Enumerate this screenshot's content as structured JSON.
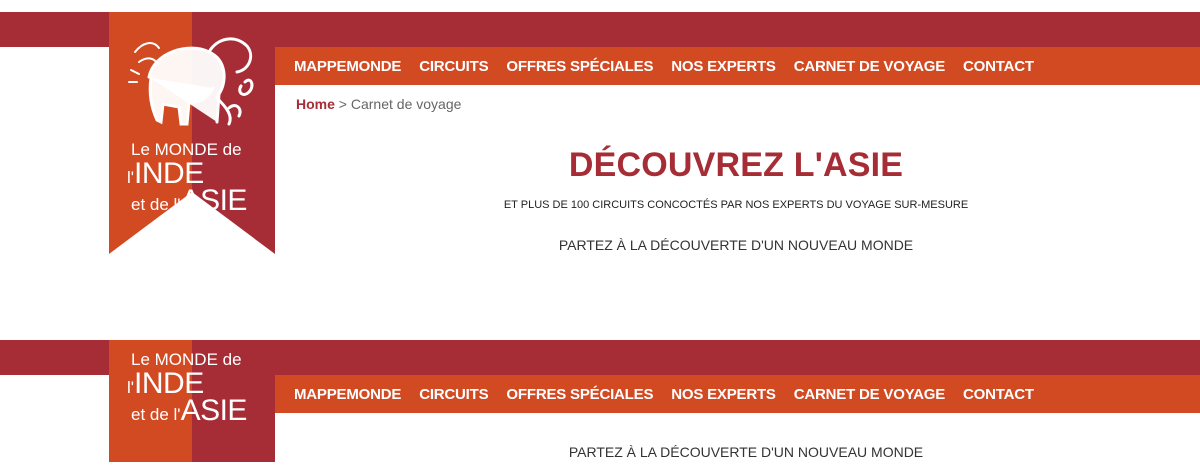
{
  "brand": {
    "line1": "Le MONDE de",
    "line2_small": "l'",
    "line2_big": "INDE",
    "line3_small": "et de l'",
    "line3_big": "ASIE",
    "colors": {
      "primary": "#a62d36",
      "accent": "#d24a22"
    }
  },
  "nav": {
    "items": [
      "MAPPEMONDE",
      "CIRCUITS",
      "OFFRES SPÉCIALES",
      "NOS EXPERTS",
      "CARNET DE VOYAGE",
      "CONTACT"
    ]
  },
  "breadcrumb": {
    "home": "Home",
    "separator": ">",
    "current": "Carnet de voyage"
  },
  "hero": {
    "title": "DÉCOUVREZ L'ASIE",
    "subtitle": "ET PLUS DE 100 CIRCUITS CONCOCTÉS PAR NOS EXPERTS DU VOYAGE SUR-MESURE",
    "tagline": "PARTEZ À LA DÉCOUVERTE D'UN NOUVEAU MONDE"
  },
  "sticky": {
    "tagline": "PARTEZ À LA DÉCOUVERTE D'UN NOUVEAU MONDE"
  },
  "icons": {
    "logo": "elephant-icon"
  }
}
